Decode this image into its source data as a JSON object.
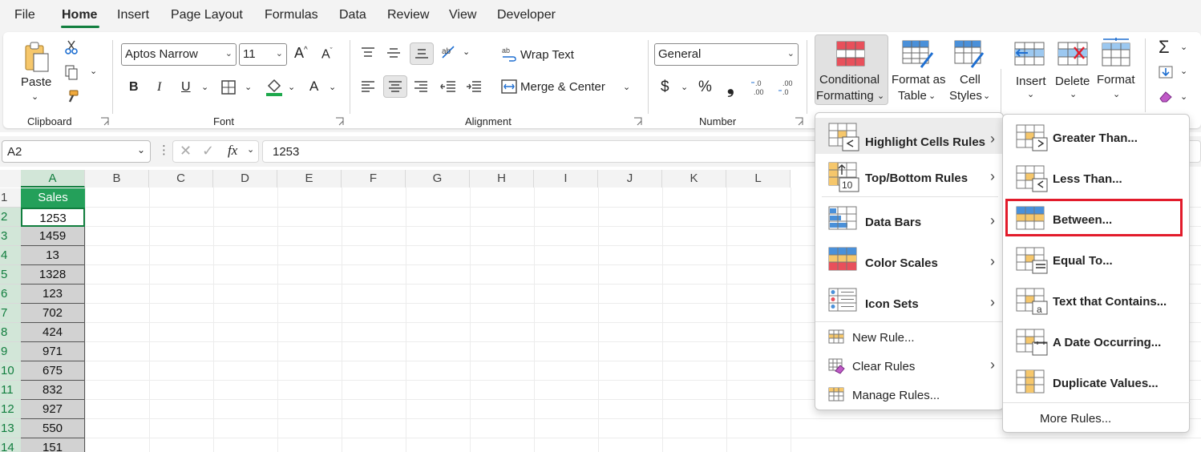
{
  "menu_tabs": [
    "File",
    "Home",
    "Insert",
    "Page Layout",
    "Formulas",
    "Data",
    "Review",
    "View",
    "Developer"
  ],
  "active_tab": "Home",
  "ribbon": {
    "clipboard": {
      "paste": "Paste",
      "label": "Clipboard"
    },
    "font": {
      "font_name": "Aptos Narrow",
      "font_size": "11",
      "label": "Font",
      "bold": "B",
      "italic": "I",
      "underline": "U"
    },
    "alignment": {
      "wrap_text": "Wrap Text",
      "merge_center": "Merge & Center",
      "label": "Alignment"
    },
    "number": {
      "format": "General",
      "currency": "$",
      "percent": "%",
      "comma": "❟",
      "label": "Number"
    },
    "styles": {
      "conditional_formatting_line1": "Conditional",
      "conditional_formatting_line2": "Formatting",
      "format_as_table_line1": "Format as",
      "format_as_table_line2": "Table",
      "cell_styles_line1": "Cell",
      "cell_styles_line2": "Styles"
    },
    "cells": {
      "insert": "Insert",
      "delete": "Delete",
      "format": "Format"
    }
  },
  "formula_bar": {
    "name_box": "A2",
    "fx": "fx",
    "value": "1253"
  },
  "columns": [
    "A",
    "B",
    "C",
    "D",
    "E",
    "F",
    "G",
    "H",
    "I",
    "J",
    "K",
    "L"
  ],
  "rows": [
    "1",
    "2",
    "3",
    "4",
    "5",
    "6",
    "7",
    "8",
    "9",
    "10",
    "11",
    "12",
    "13",
    "14"
  ],
  "column_a": [
    "Sales",
    "1253",
    "1459",
    "13",
    "1328",
    "123",
    "702",
    "424",
    "971",
    "675",
    "832",
    "927",
    "550",
    "151"
  ],
  "cf_menu": {
    "items": [
      {
        "label": "Highlight Cells Rules",
        "arrow": "›"
      },
      {
        "label": "Top/Bottom Rules",
        "arrow": "›"
      },
      {
        "label": "Data Bars",
        "arrow": "›"
      },
      {
        "label": "Color Scales",
        "arrow": "›"
      },
      {
        "label": "Icon Sets",
        "arrow": "›"
      }
    ],
    "new_rule": "New Rule...",
    "clear_rules": "Clear Rules",
    "clear_arrow": "›",
    "manage_rules": "Manage Rules..."
  },
  "highlight_submenu": {
    "items": [
      "Greater Than...",
      "Less Than...",
      "Between...",
      "Equal To...",
      "Text that Contains...",
      "A Date Occurring...",
      "Duplicate Values..."
    ],
    "more_rules": "More Rules..."
  },
  "colors": {
    "accent_green": "#117e3e",
    "header_fill": "#24a05a",
    "highlight_red": "#e21b2b"
  }
}
